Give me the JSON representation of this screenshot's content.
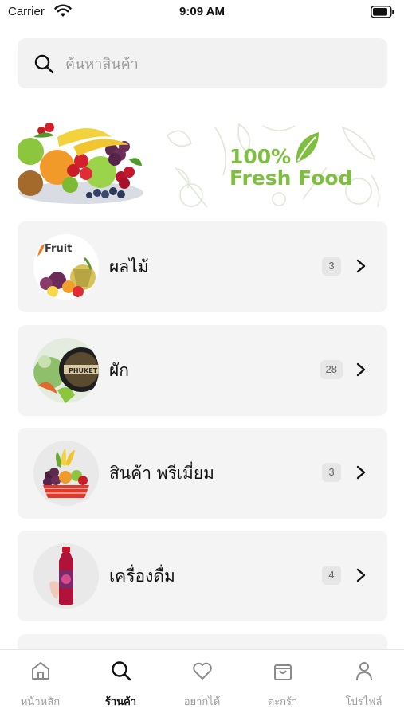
{
  "status_bar": {
    "carrier": "Carrier",
    "time": "9:09 AM"
  },
  "search": {
    "placeholder": "ค้นหาสินค้า",
    "value": ""
  },
  "banner": {
    "line1": "100%",
    "line2": "Fresh Food",
    "accent_color": "#7fbf3f"
  },
  "categories": [
    {
      "label": "ผลไม้",
      "count": "3",
      "thumb_text": "Fruit"
    },
    {
      "label": "ผัก",
      "count": "28",
      "thumb_text": "PHUKET"
    },
    {
      "label": "สินค้า พรีเมี่ยม",
      "count": "3"
    },
    {
      "label": "เครื่องดื่ม",
      "count": "4"
    }
  ],
  "tabbar": {
    "items": [
      {
        "label": "หน้าหลัก",
        "icon": "home-icon",
        "active": false
      },
      {
        "label": "ร้านค้า",
        "icon": "search-icon",
        "active": true
      },
      {
        "label": "อยากได้",
        "icon": "heart-icon",
        "active": false
      },
      {
        "label": "ตะกร้า",
        "icon": "bag-icon",
        "active": false
      },
      {
        "label": "โปรไฟล์",
        "icon": "person-icon",
        "active": false
      }
    ]
  }
}
